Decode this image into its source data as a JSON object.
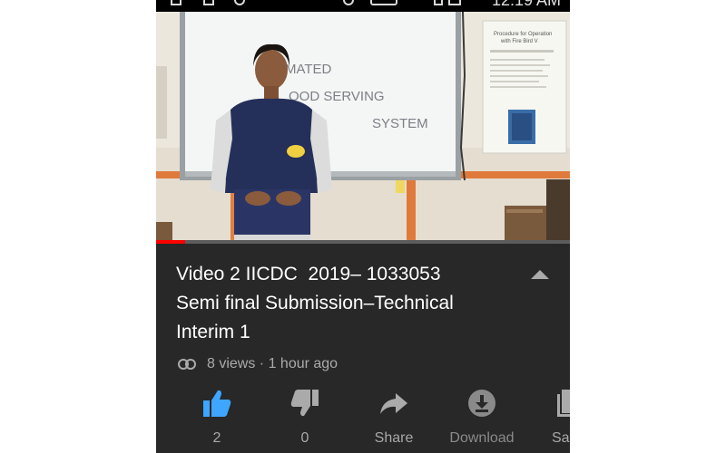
{
  "status_bar": {
    "clock": "12:19 AM"
  },
  "video": {
    "progress": 0.07,
    "whiteboard_text": [
      "MATED",
      "OOD SERVING",
      "SYSTEM"
    ],
    "poster": {
      "header": "Procedure for Operation",
      "subheader": "with Fire Bird V"
    }
  },
  "title": {
    "line1": "Video 2 IICDC  2019– 1033053",
    "line2": "Semi final Submission–Technical",
    "line3": "Interim 1"
  },
  "meta": {
    "views": "8 views · 1 hour ago"
  },
  "actions": {
    "like": "2",
    "dislike": "0",
    "share": "Share",
    "download": "Download",
    "save": "Sa"
  },
  "colors": {
    "like_active": "#3ea6ff",
    "progress": "#ff0000",
    "panel": "#282828"
  }
}
